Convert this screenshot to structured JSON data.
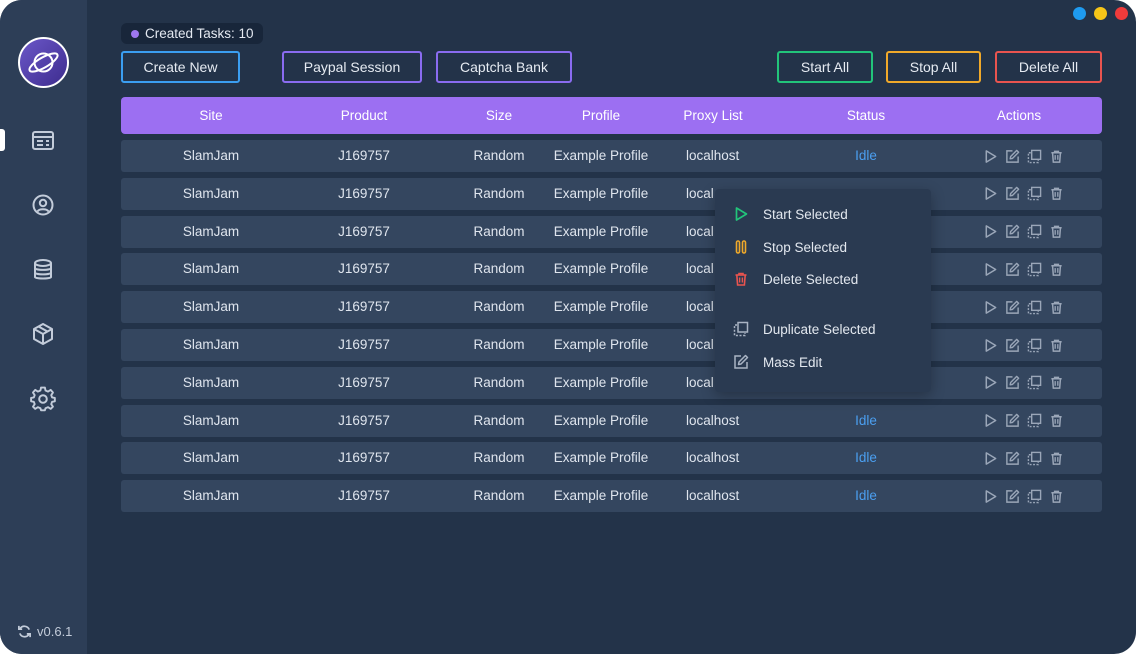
{
  "sidebar": {
    "nav": [
      {
        "name": "tasks",
        "icon": "task-list-icon",
        "active": true
      },
      {
        "name": "profiles",
        "icon": "user-circle-icon",
        "active": false
      },
      {
        "name": "proxies",
        "icon": "database-icon",
        "active": false
      },
      {
        "name": "products",
        "icon": "package-box-icon",
        "active": false
      },
      {
        "name": "settings",
        "icon": "gear-icon",
        "active": false
      }
    ],
    "version": "v0.6.1"
  },
  "window_controls": {
    "colors": [
      "#1e9bf0",
      "#f5c518",
      "#ef3b3b"
    ]
  },
  "header": {
    "task_count_label": "Created Tasks: 10",
    "buttons": {
      "create_new": "Create New",
      "paypal_session": "Paypal Session",
      "captcha_bank": "Captcha Bank",
      "start_all": "Start All",
      "stop_all": "Stop All",
      "delete_all": "Delete All"
    }
  },
  "colors": {
    "accent": "#9c6ff2",
    "create_border": "#3b9ef0",
    "purple_border": "#8a6cf0",
    "start_border": "#22c47a",
    "stop_border": "#f0a92a",
    "delete_border": "#e9544f",
    "status_idle": "#4b9ff0"
  },
  "table": {
    "columns": [
      "Site",
      "Product",
      "Size",
      "Profile",
      "Proxy List",
      "Status",
      "Actions"
    ],
    "rows": [
      {
        "site": "SlamJam",
        "product": "J169757",
        "size": "Random",
        "profile": "Example Profile",
        "proxy": "localhost",
        "status": "Idle"
      },
      {
        "site": "SlamJam",
        "product": "J169757",
        "size": "Random",
        "profile": "Example Profile",
        "proxy": "local",
        "status": ""
      },
      {
        "site": "SlamJam",
        "product": "J169757",
        "size": "Random",
        "profile": "Example Profile",
        "proxy": "local",
        "status": ""
      },
      {
        "site": "SlamJam",
        "product": "J169757",
        "size": "Random",
        "profile": "Example Profile",
        "proxy": "local",
        "status": ""
      },
      {
        "site": "SlamJam",
        "product": "J169757",
        "size": "Random",
        "profile": "Example Profile",
        "proxy": "local",
        "status": ""
      },
      {
        "site": "SlamJam",
        "product": "J169757",
        "size": "Random",
        "profile": "Example Profile",
        "proxy": "local",
        "status": ""
      },
      {
        "site": "SlamJam",
        "product": "J169757",
        "size": "Random",
        "profile": "Example Profile",
        "proxy": "local",
        "status": ""
      },
      {
        "site": "SlamJam",
        "product": "J169757",
        "size": "Random",
        "profile": "Example Profile",
        "proxy": "localhost",
        "status": "Idle"
      },
      {
        "site": "SlamJam",
        "product": "J169757",
        "size": "Random",
        "profile": "Example Profile",
        "proxy": "localhost",
        "status": "Idle"
      },
      {
        "site": "SlamJam",
        "product": "J169757",
        "size": "Random",
        "profile": "Example Profile",
        "proxy": "localhost",
        "status": "Idle"
      }
    ],
    "row_actions": [
      "play-icon",
      "edit-icon",
      "duplicate-icon",
      "trash-icon"
    ]
  },
  "context_menu": {
    "items": [
      {
        "label": "Start Selected",
        "icon": "play-icon",
        "color": "#22c47a"
      },
      {
        "label": "Stop Selected",
        "icon": "pause-icon",
        "color": "#f0a92a"
      },
      {
        "label": "Delete Selected",
        "icon": "trash-icon",
        "color": "#e9544f"
      },
      {
        "label": "Duplicate Selected",
        "icon": "duplicate-icon",
        "color": "#aab4c4"
      },
      {
        "label": "Mass Edit",
        "icon": "edit-icon",
        "color": "#aab4c4"
      }
    ]
  }
}
